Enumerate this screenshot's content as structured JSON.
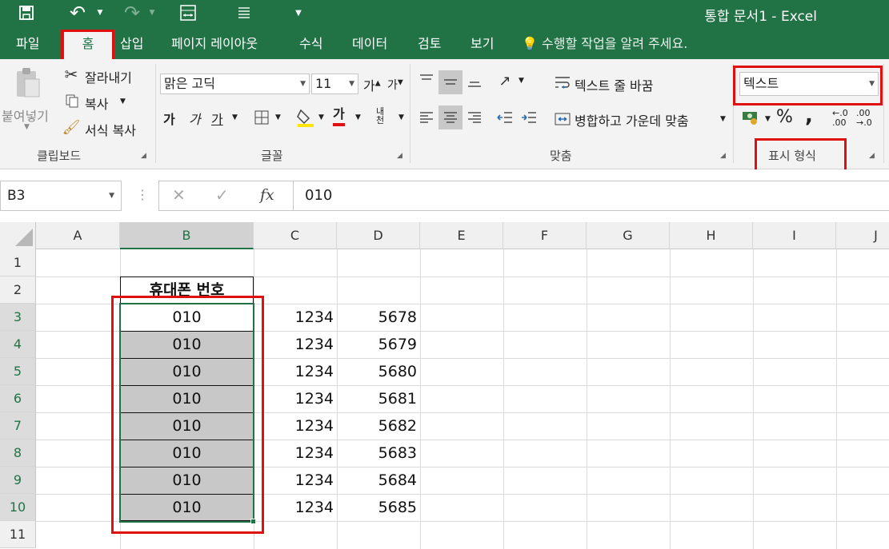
{
  "window": {
    "title": "통합 문서1 - Excel"
  },
  "tabs": [
    {
      "label": "파일"
    },
    {
      "label": "홈"
    },
    {
      "label": "삽입"
    },
    {
      "label": "페이지 레이아웃"
    },
    {
      "label": "수식"
    },
    {
      "label": "데이터"
    },
    {
      "label": "검토"
    },
    {
      "label": "보기"
    }
  ],
  "tellme": "수행할 작업을 알려 주세요.",
  "clipboard": {
    "paste": "붙여넣기",
    "cut": "잘라내기",
    "copy": "복사",
    "format_painter": "서식 복사",
    "group": "클립보드"
  },
  "font": {
    "name": "맑은 고딕",
    "size": "11",
    "group": "글꼴",
    "bold": "가",
    "italic": "가",
    "underline": "가",
    "grow": "가",
    "shrink": "가",
    "color_letter": "가",
    "phonetic": "내천"
  },
  "alignment": {
    "wrap": "텍스트 줄 바꿈",
    "merge": "병합하고 가운데 맞춤",
    "group": "맞춤"
  },
  "number": {
    "format": "텍스트",
    "percent": "%",
    "comma": ",",
    "inc_decimal": "←.0 .00",
    "dec_decimal": ".00 →.0",
    "group": "표시 형식"
  },
  "formula_bar": {
    "name_box": "B3",
    "formula": "010",
    "cancel": "✕",
    "enter": "✓",
    "fx": "fx"
  },
  "columns": [
    "A",
    "B",
    "C",
    "D",
    "E",
    "F",
    "G",
    "H",
    "I",
    "J"
  ],
  "rows": [
    "1",
    "2",
    "3",
    "4",
    "5",
    "6",
    "7",
    "8",
    "9",
    "10",
    "11"
  ],
  "sheet": {
    "header_b2": "휴대폰 번호",
    "b_values": [
      "010",
      "010",
      "010",
      "010",
      "010",
      "010",
      "010",
      "010"
    ],
    "c_values": [
      "1234",
      "1234",
      "1234",
      "1234",
      "1234",
      "1234",
      "1234",
      "1234"
    ],
    "d_values": [
      "5678",
      "5679",
      "5680",
      "5681",
      "5682",
      "5683",
      "5684",
      "5685"
    ]
  },
  "colors": {
    "excel_green": "#217346",
    "annotation_red": "#e01010",
    "selection_fill": "#c8c8c8"
  }
}
